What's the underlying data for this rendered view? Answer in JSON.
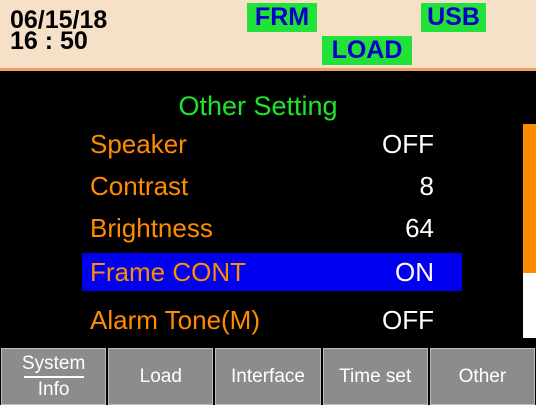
{
  "status": {
    "date": "06/15/18",
    "time": "16 : 50",
    "badges": {
      "frm": "FRM",
      "usb": "USB",
      "load": "LOAD"
    }
  },
  "panel": {
    "title": "Other Setting",
    "rows": [
      {
        "label": "Speaker",
        "value": "OFF"
      },
      {
        "label": "Contrast",
        "value": "8"
      },
      {
        "label": "Brightness",
        "value": "64"
      },
      {
        "label": "Frame CONT",
        "value": "ON"
      },
      {
        "label": "Alarm Tone(M)",
        "value": "OFF"
      }
    ],
    "selected_row": "Frame CONT"
  },
  "softkeys": {
    "system_info_top": "System",
    "system_info_bottom": "Info",
    "load": "Load",
    "interface": "Interface",
    "time_set": "Time set",
    "other": "Other"
  },
  "colors": {
    "status_bg": "#f7e0c8",
    "badge_bg": "#22e23a",
    "badge_text": "#0000c8",
    "title": "#1ee52b",
    "label": "#ff8c00",
    "selected_bg": "#0000f0",
    "softkey_bg": "#8c8c8c"
  }
}
